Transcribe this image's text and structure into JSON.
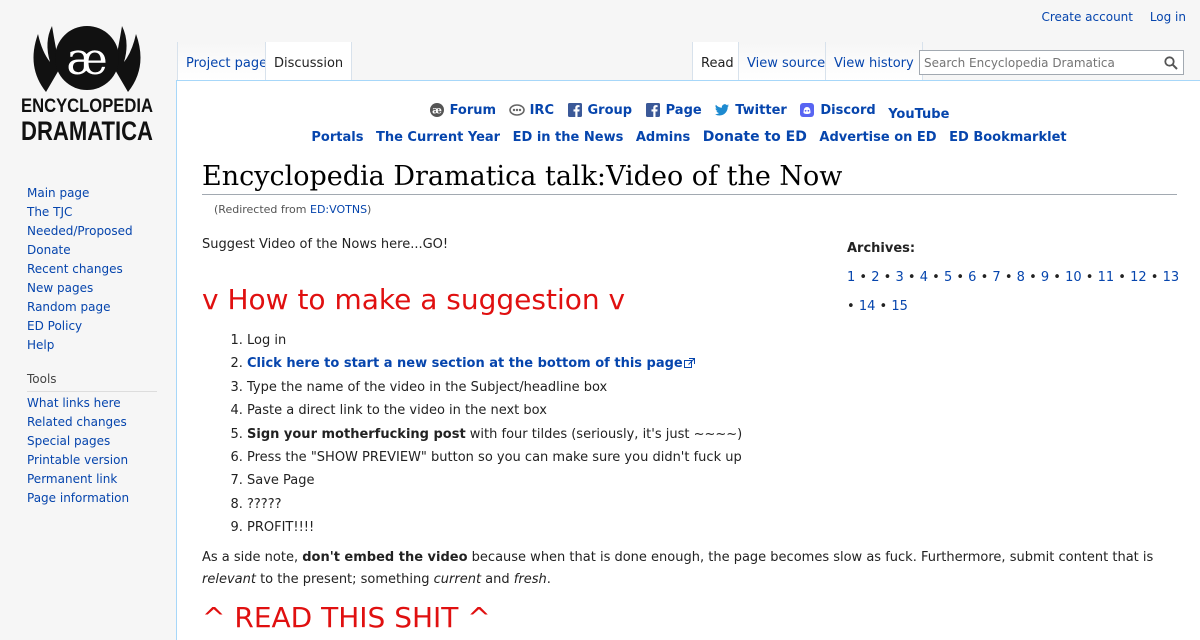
{
  "personal": {
    "create_account": "Create account",
    "login": "Log in"
  },
  "logo": {
    "text_top": "ENCYCLOPEDIA",
    "text_bottom": "DRAMATICA",
    "symbol": "æ"
  },
  "tabs": {
    "project": "Project page",
    "discussion": "Discussion",
    "read": "Read",
    "view_source": "View source",
    "view_history": "View history"
  },
  "search": {
    "placeholder": "Search Encyclopedia Dramatica"
  },
  "sidebar": {
    "nav": [
      "Main page",
      "The TJC",
      "Needed/Proposed",
      "Donate",
      "Recent changes",
      "New pages",
      "Random page",
      "ED Policy",
      "Help"
    ],
    "tools_heading": "Tools",
    "tools": [
      "What links here",
      "Related changes",
      "Special pages",
      "Printable version",
      "Permanent link",
      "Page information"
    ]
  },
  "social": [
    {
      "label": "Forum",
      "icon": "forum-icon"
    },
    {
      "label": "IRC",
      "icon": "irc-icon"
    },
    {
      "label": "Group",
      "icon": "facebook-icon"
    },
    {
      "label": "Page",
      "icon": "facebook-icon"
    },
    {
      "label": "Twitter",
      "icon": "twitter-icon"
    },
    {
      "label": "Discord",
      "icon": "discord-icon"
    },
    {
      "label": "YouTube",
      "icon": ""
    }
  ],
  "portals": [
    "Portals",
    "The Current Year",
    "ED in the News",
    "Admins",
    "Donate to ED",
    "Advertise on ED",
    "ED Bookmarklet"
  ],
  "page": {
    "title": "Encyclopedia Dramatica talk:Video of the Now",
    "redirect_prefix": "(Redirected from ",
    "redirect_link": "ED:VOTNS",
    "redirect_suffix": ")",
    "intro": "Suggest Video of the Nows here...GO!",
    "heading_suggest": "v How to make a suggestion v",
    "steps": {
      "s1": "Log in",
      "s2_link": "Click here to start a new section at the bottom of this page",
      "s3": "Type the name of the video in the Subject/headline box",
      "s4": "Paste a direct link to the video in the next box",
      "s5_bold": "Sign your motherfucking post",
      "s5_rest": " with four tildes (seriously, it's just ~~~~)",
      "s6": "Press the \"SHOW PREVIEW\" button so you can make sure you didn't fuck up",
      "s7": "Save Page",
      "s8": "?????",
      "s9": "PROFIT!!!!"
    },
    "sidenote": {
      "a": "As a side note, ",
      "b_bold": "don't embed the video",
      "c": " because when that is done enough, the page becomes slow as fuck. Furthermore, submit content that is ",
      "d_italic": "relevant",
      "e": " to the present; something ",
      "f_italic": "current",
      "g": " and ",
      "h_italic": "fresh",
      "i": "."
    },
    "heading_read": "^ READ THIS SHIT ^"
  },
  "archives": {
    "heading": "Archives:",
    "links": [
      "1",
      "2",
      "3",
      "4",
      "5",
      "6",
      "7",
      "8",
      "9",
      "10",
      "11",
      "12",
      "13",
      "14",
      "15"
    ],
    "separator": "•"
  },
  "colors": {
    "link": "#0645ad",
    "heading_red": "#e01010",
    "content_border": "#a7d7f9"
  }
}
